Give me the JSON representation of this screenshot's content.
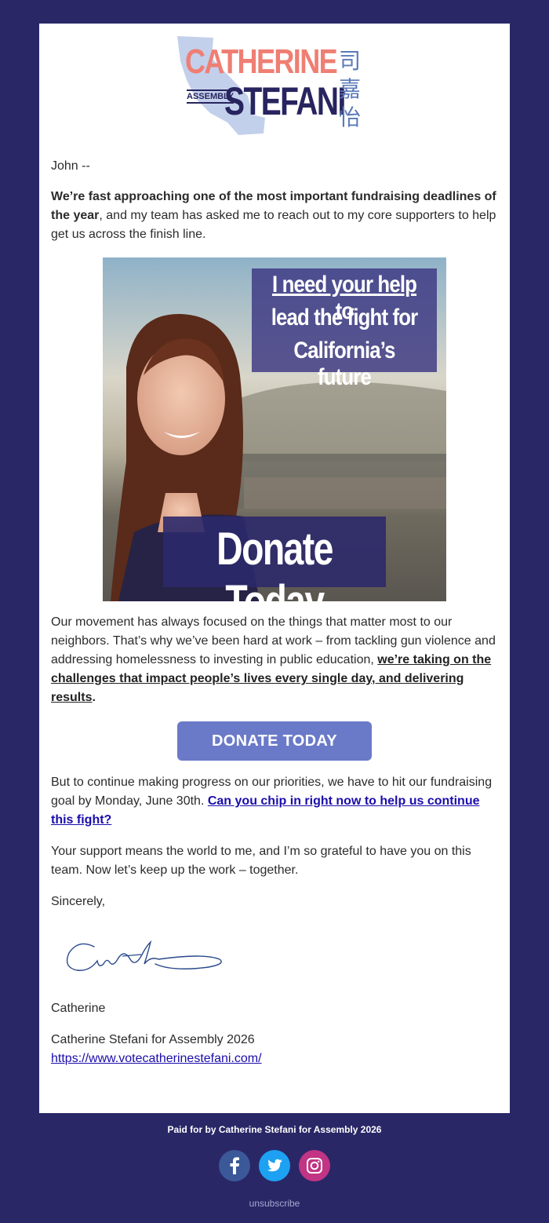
{
  "logo": {
    "first_name": "CATHERINE",
    "last_name": "STEFANI",
    "assembly": "ASSEMBLY",
    "chinese": [
      "司",
      "嘉",
      "怡"
    ]
  },
  "greeting": "John --",
  "para1": {
    "bold": "We’re fast approaching one of the most important fundraising deadlines of the year",
    "rest": ", and my team has asked me to reach out to my core supporters to help get us across the finish line."
  },
  "hero": {
    "headline_underlined": "I need your help",
    "headline_tail": " to",
    "line2": "lead the fight for",
    "line3": "California’s future",
    "button": "Donate Today"
  },
  "para2": {
    "plain": "Our movement has always focused on the things that matter most to our neighbors. That’s why we’ve been hard at work – from tackling gun violence and addressing homelessness to investing in public education, ",
    "emph": "we’re taking on the challenges that impact people’s lives every single day, and delivering results",
    "end": "."
  },
  "donate_button": "DONATE TODAY",
  "para3": {
    "plain": "But to continue making progress on our priorities, we have to hit our fundraising goal by Monday, June 30th. ",
    "link": "Can you chip in right now to help us continue this fight?"
  },
  "para4": "Your support means the world to me, and I’m so grateful to have you on this team. Now let’s keep up the work – together.",
  "closing": "Sincerely,",
  "sign_name": "Catherine",
  "org": "Catherine Stefani for Assembly 2026",
  "url": "https://www.votecatherinestefani.com/",
  "footer": {
    "paid_for": "Paid for by Catherine Stefani for Assembly 2026",
    "unsubscribe": "unsubscribe"
  },
  "colors": {
    "background": "#2a2767",
    "accent_salmon": "#ef7e73",
    "navy": "#27245f",
    "button": "#6a7ac8",
    "facebook": "#3b5998",
    "twitter": "#1da1f2",
    "instagram": "#c13584"
  }
}
